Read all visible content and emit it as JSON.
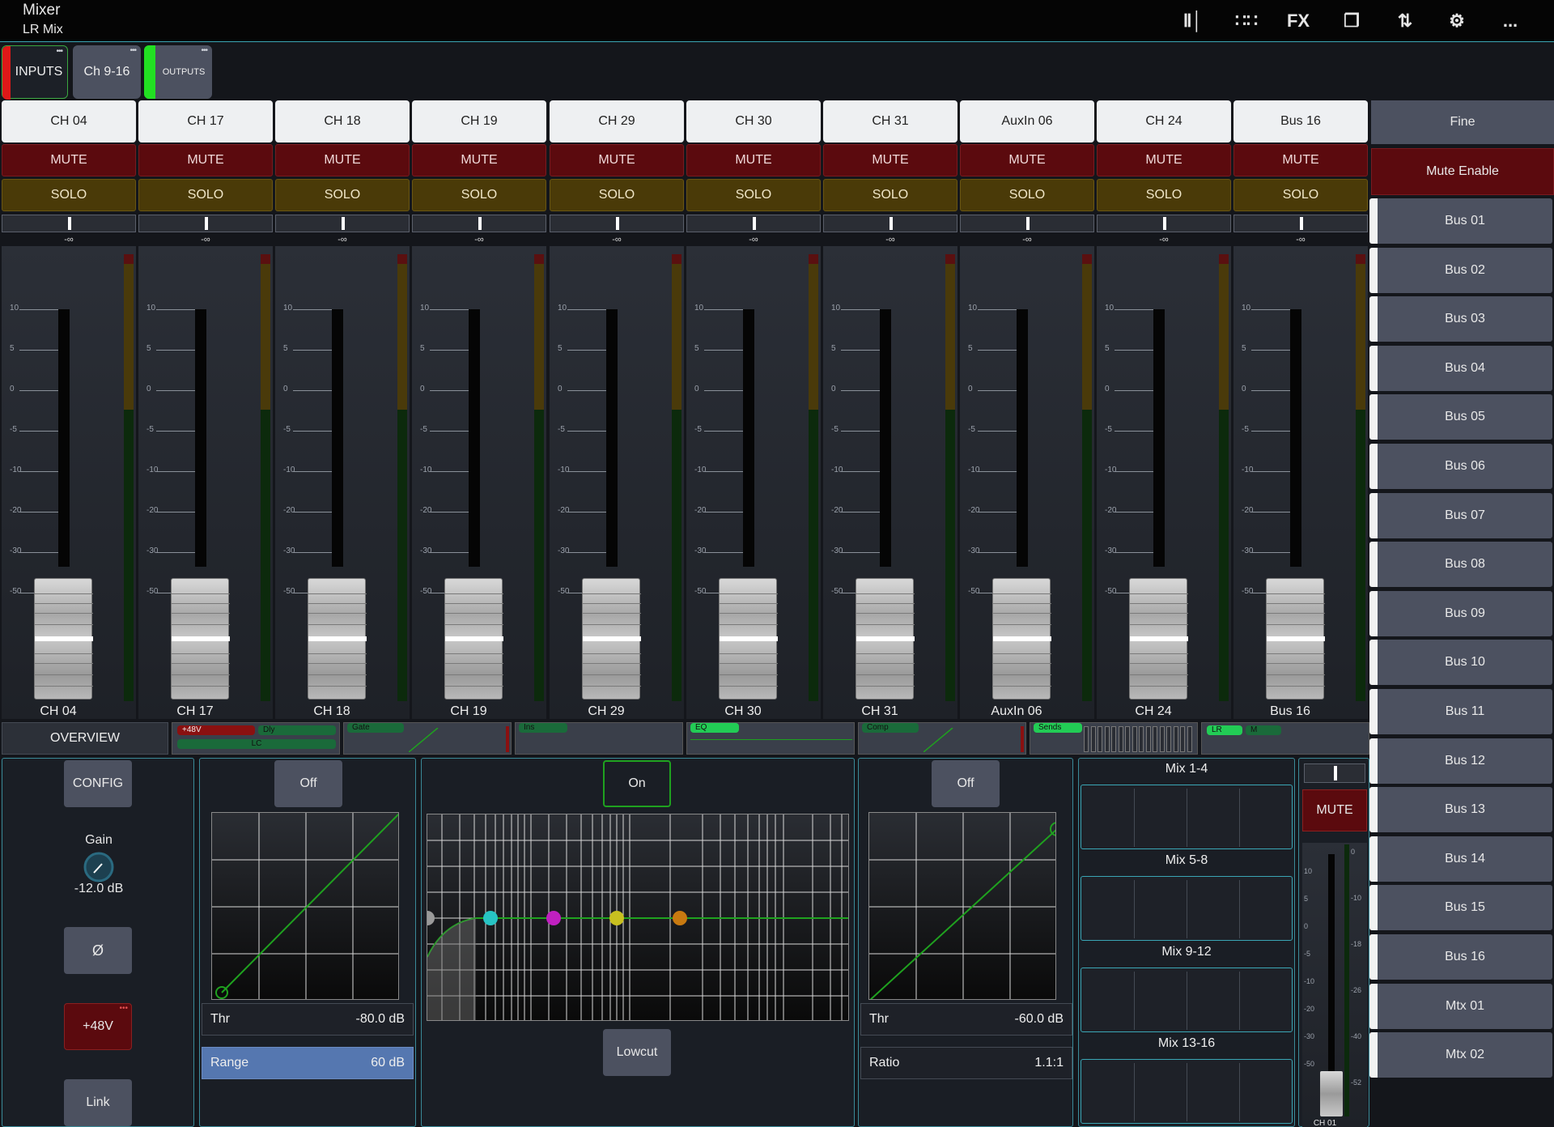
{
  "app": {
    "title": "Mixer",
    "subtitle": "LR Mix"
  },
  "toolbar": [
    {
      "name": "meters-icon",
      "glyph": "Ⅱ│"
    },
    {
      "name": "grid-icon",
      "glyph": "∷∷"
    },
    {
      "name": "fx-icon",
      "glyph": "FX"
    },
    {
      "name": "folder-icon",
      "glyph": "❐"
    },
    {
      "name": "transfer-icon",
      "glyph": "⇅"
    },
    {
      "name": "settings-icon",
      "glyph": "⚙"
    },
    {
      "name": "more-icon",
      "glyph": "..."
    }
  ],
  "layers": {
    "inputs": "INPUTS",
    "ch916": "Ch 9-16",
    "outputs": "OUTPUTS"
  },
  "strip_common": {
    "mute": "MUTE",
    "solo": "SOLO",
    "pan_value": "-∞",
    "scale": [
      "10",
      "5",
      "0",
      "-5",
      "-10",
      "-20",
      "-30",
      "-50"
    ]
  },
  "channels": [
    {
      "name": "CH 04"
    },
    {
      "name": "CH 17"
    },
    {
      "name": "CH 18"
    },
    {
      "name": "CH 19"
    },
    {
      "name": "CH 29"
    },
    {
      "name": "CH 30"
    },
    {
      "name": "CH 31"
    },
    {
      "name": "AuxIn 06"
    },
    {
      "name": "CH 24"
    },
    {
      "name": "Bus 16"
    }
  ],
  "right": {
    "fine": "Fine",
    "mute_enable": "Mute Enable",
    "buses": [
      "Bus 01",
      "Bus 02",
      "Bus 03",
      "Bus 04",
      "Bus 05",
      "Bus 06",
      "Bus 07",
      "Bus 08",
      "Bus 09",
      "Bus 10",
      "Bus 11",
      "Bus 12",
      "Bus 13",
      "Bus 14",
      "Bus 15",
      "Bus 16",
      "Mtx 01",
      "Mtx 02"
    ]
  },
  "processing": {
    "overview": "OVERVIEW",
    "pills": {
      "phantom": "+48V",
      "delay": "Dly",
      "lowcut": "LC",
      "gate": "Gate",
      "insert": "Ins",
      "eq": "EQ",
      "comp": "Comp",
      "sends": "Sends",
      "lr": "LR",
      "m": "M"
    }
  },
  "preamp": {
    "config": "CONFIG",
    "gain_label": "Gain",
    "gain_value": "-12.0 dB",
    "phase": "Ø",
    "phantom": "+48V",
    "link": "Link"
  },
  "gate": {
    "state": "Off",
    "thr_label": "Thr",
    "thr_value": "-80.0 dB",
    "range_label": "Range",
    "range_value": "60 dB"
  },
  "eq": {
    "state": "On",
    "lowcut": "Lowcut",
    "band_colors": [
      "#9a9a9a",
      "#27c4c4",
      "#c020c0",
      "#c8c020",
      "#c87a10"
    ]
  },
  "comp": {
    "state": "Off",
    "thr_label": "Thr",
    "thr_value": "-60.0 dB",
    "ratio_label": "Ratio",
    "ratio_value": "1.1:1"
  },
  "mixes": [
    "Mix 1-4",
    "Mix 5-8",
    "Mix 9-12",
    "Mix 13-16"
  ],
  "master": {
    "mute": "MUTE",
    "label": "CH 01",
    "scale": [
      "10",
      "5",
      "0",
      "-5",
      "-10",
      "-20",
      "-30",
      "-50"
    ],
    "meter_scale": [
      "0",
      "-10",
      "-18",
      "-26",
      "-40",
      "-52"
    ]
  },
  "colors": {
    "mute": "#5b0a0e",
    "solo": "#4a3a08",
    "accent": "#3aa6b5",
    "green": "#1fa11f"
  }
}
